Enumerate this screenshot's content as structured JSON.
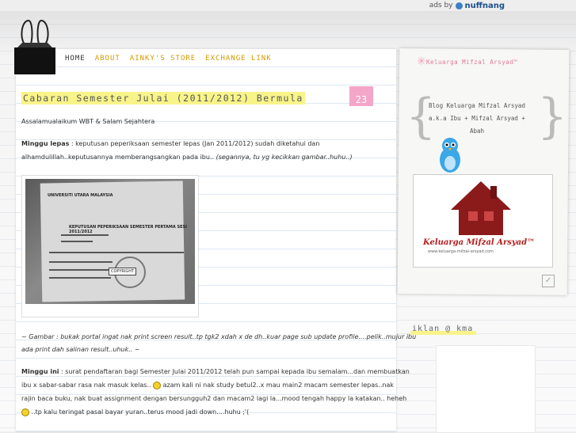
{
  "adbar": {
    "ads_by": "ads by",
    "brand": "nuffnang"
  },
  "nav": {
    "items": [
      {
        "label": "HOME",
        "active": true
      },
      {
        "label": "ABOUT"
      },
      {
        "label": "AINKY'S STORE"
      },
      {
        "label": "EXCHANGE LINK"
      }
    ]
  },
  "post": {
    "title": "Cabaran Semester Julai (2011/2012) Bermula",
    "date_day": "23",
    "greeting": "Assalamualaikum WBT & Salam Sejahtera",
    "p1_label": "Minggu lepas",
    "p1_text": " : keputusan peperiksaan semester lepas (Jan 2011/2012) sudah diketahui dan",
    "p1_text2": "alhamdulillah..keputusannya  memberangsangkan pada ibu.. ",
    "p1_italic": "(segannya, tu yg kecikkan gambar..huhu..)",
    "photo": {
      "university": "UNIVERSITI UTARA MALAYSIA",
      "heading": "KEPUTUSAN PEPERIKSAAN SEMESTER PERTAMA SESI 2011/2012",
      "stamp": "COPYRIGHT"
    },
    "caption1": "~ Gambar : bukak portal ingat nak print screen result..tp tgk2 xdah x de dh..kuar page sub update profile....pelik..mujur ibu",
    "caption2": "ada print dah salinan result..uhuk.. ~",
    "p2_label": "Minggu ini",
    "p2_line1": " : surat pendaftaran bagi Semester Julai 2011/2012 telah pun sampai kepada ibu semalam...dan membuatkan",
    "p2_line2a": "ibu x sabar-sabar rasa nak masuk kelas.. ",
    "p2_line2b": " azam kali ni nak study betul2..x mau main2 macam semester lepas..nak",
    "p2_line3": "rajin baca buku, nak buat assignment dengan bersungguh2 dan macam2 lagi la...mood tengah happy la katakan.. heheh",
    "p2_line4": " ..tp kalu teringat pasal bayar yuran..terus mood jadi down....huhu ;'("
  },
  "sidebar": {
    "widget1_title": "Keluarga Mifzal Arsyad™",
    "widget1_text": "Blog Keluarga Mifzal Arsyad a.k.a Ibu + Mifzal Arsyad + Abah",
    "logo_caption": "Keluarga Mifzal Arsyad™",
    "logo_url": "www.keluarga-mifzal-arsyad.com",
    "widget2_title": "iklan @ kma"
  },
  "colors": {
    "highlight": "#f8f48a",
    "badge": "#f3a6c8",
    "nav_accent": "#d59a00",
    "logo_red": "#b21e1e"
  }
}
